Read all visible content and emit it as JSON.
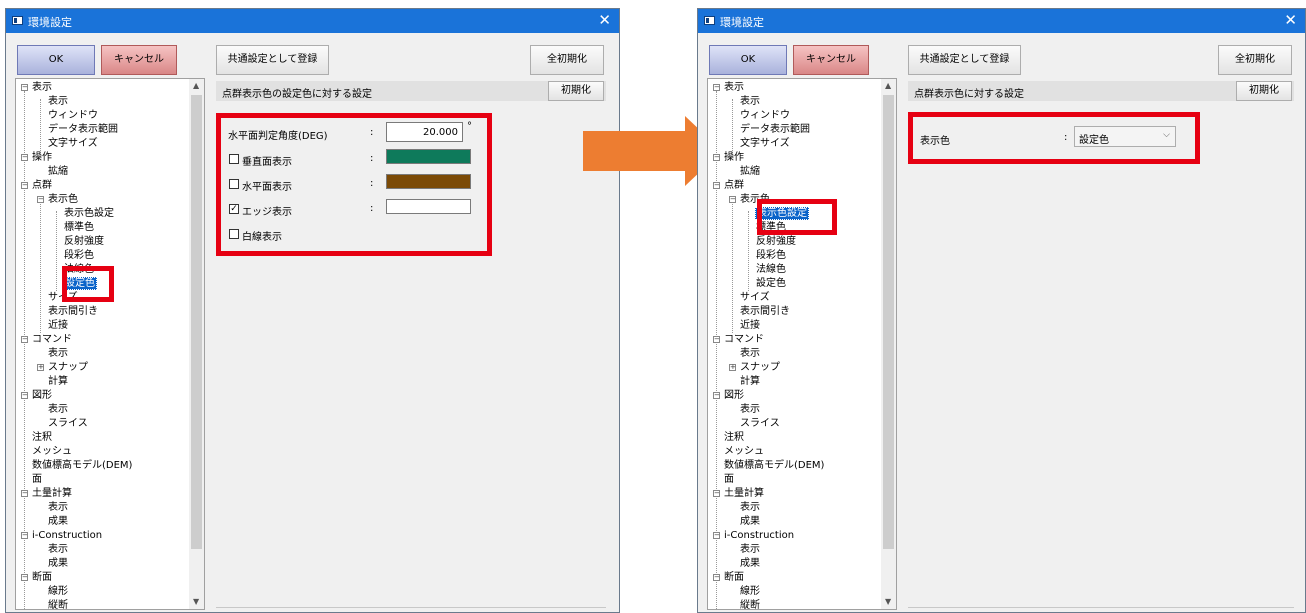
{
  "window_title": "環境設定",
  "close_glyph": "✕",
  "buttons": {
    "ok": "OK",
    "cancel": "キャンセル",
    "register_common": "共通設定として登録",
    "reset_all": "全初期化",
    "reset": "初期化"
  },
  "left": {
    "section_header": "点群表示色の設定色に対する設定",
    "rows": {
      "horizontal_angle_label": "水平面判定角度(DEG)",
      "horizontal_angle_value": "20.000",
      "degree_unit": "°",
      "vertical_label": "垂直面表示",
      "horizontal_label": "水平面表示",
      "edge_label": "エッジ表示",
      "white_line_label": "白線表示",
      "colon": ":"
    },
    "colors": {
      "vertical": "#0e7a5b",
      "horizontal": "#7b4a06",
      "edge": "#ffffff"
    }
  },
  "right": {
    "section_header": "点群表示色に対する設定",
    "display_color_label": "表示色",
    "colon": ":",
    "display_color_value": "設定色"
  },
  "tree": {
    "n0": "表示",
    "n1": "表示",
    "n2": "ウィンドウ",
    "n3": "データ表示範囲",
    "n4": "文字サイズ",
    "n5": "操作",
    "n6": "拡縮",
    "n7": "点群",
    "n8": "表示色",
    "n9": "表示色設定",
    "n10": "標準色",
    "n11": "反射強度",
    "n12": "段彩色",
    "n13": "法線色",
    "n14": "設定色",
    "n15": "サイズ",
    "n16": "表示間引き",
    "n17": "近接",
    "n18": "コマンド",
    "n19": "表示",
    "n20": "スナップ",
    "n21": "計算",
    "n22": "図形",
    "n23": "表示",
    "n24": "スライス",
    "n25": "注釈",
    "n26": "メッシュ",
    "n27": "数値標高モデル(DEM)",
    "n28": "面",
    "n29": "土量計算",
    "n30": "表示",
    "n31": "成果",
    "n32": "i-Construction",
    "n33": "表示",
    "n34": "成果",
    "n35": "断面",
    "n36": "線形",
    "n37": "縦断"
  },
  "accent": {
    "arrow": "#ed7d31",
    "highlight_frame": "#e60012",
    "selection": "#0a63c9",
    "titlebar": "#1a73d9"
  }
}
